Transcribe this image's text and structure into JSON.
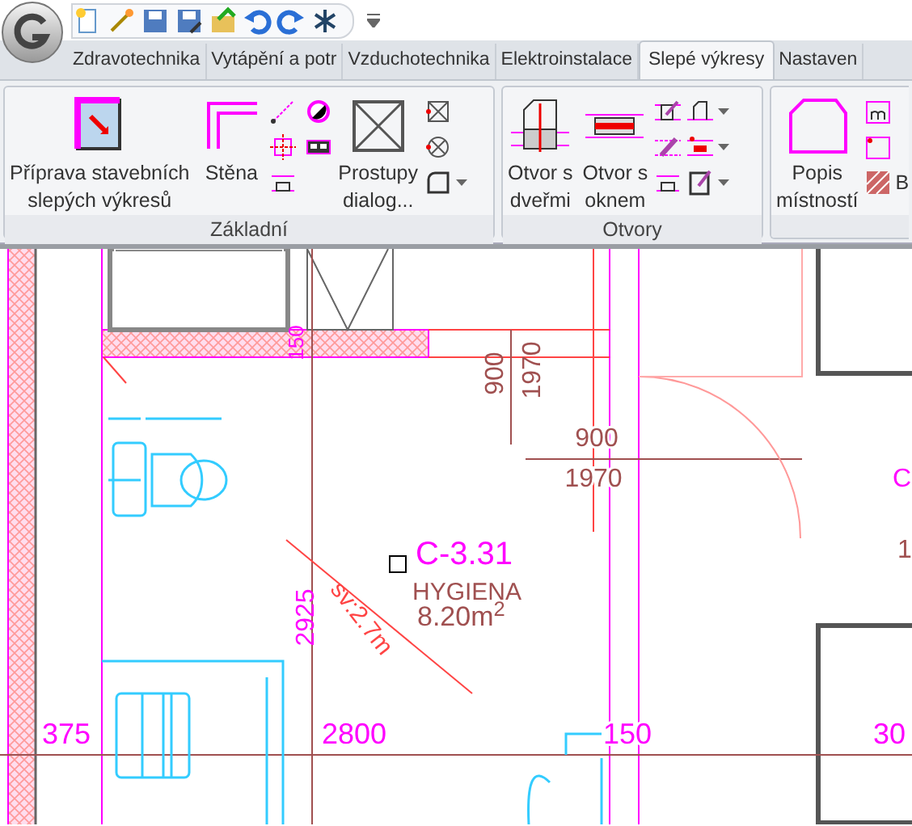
{
  "tabs": [
    {
      "label": "Zdravotechnika",
      "selected": false
    },
    {
      "label": "Vytápění a potr",
      "selected": false
    },
    {
      "label": "Vzduchotechnika",
      "selected": false
    },
    {
      "label": "Elektroinstalace",
      "selected": false
    },
    {
      "label": "Slepé výkresy",
      "selected": true
    },
    {
      "label": "Nastaven",
      "selected": false
    }
  ],
  "ribbon": [
    {
      "label": "Základní",
      "buttons": [
        {
          "lines": [
            "Příprava stavebních",
            "slepých výkresů"
          ]
        },
        {
          "lines": [
            "Stěna"
          ]
        },
        {
          "lines": [
            "Prostupy",
            "dialog..."
          ]
        }
      ]
    },
    {
      "label": "Otvory",
      "buttons": [
        {
          "lines": [
            "Otvor s",
            "dveřmi"
          ]
        },
        {
          "lines": [
            "Otvor s",
            "oknem"
          ]
        }
      ]
    },
    {
      "buttons": [
        {
          "lines": [
            "Popis",
            "místností"
          ]
        }
      ],
      "side_label": "B"
    }
  ],
  "drawing": {
    "room": {
      "number": "C-3.31",
      "name": "HYGIENA",
      "area": "8.20m$^{2}$"
    },
    "labels": [
      {
        "text": "150",
        "kind": "vertical"
      },
      {
        "text": "900",
        "kind": "vertical"
      },
      {
        "text": "1970",
        "kind": "vertical"
      },
      {
        "text": "900",
        "kind": "horizontal"
      },
      {
        "text": "1970",
        "kind": "horizontal"
      },
      {
        "text": "C",
        "kind": "horizontal"
      },
      {
        "text": "1",
        "kind": "horizontal"
      },
      {
        "text": "sv:2.7m",
        "kind": "slope"
      },
      {
        "text": "2925",
        "kind": "vertical"
      },
      {
        "text": "375",
        "kind": "horizontal"
      },
      {
        "text": "2800",
        "kind": "horizontal"
      },
      {
        "text": "150",
        "kind": "horizontal"
      },
      {
        "text": "30",
        "kind": "horizontal"
      }
    ]
  }
}
